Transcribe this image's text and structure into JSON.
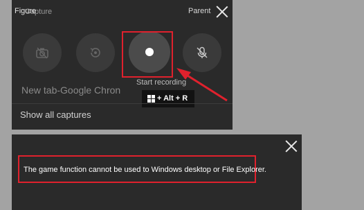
{
  "panel": {
    "title_figure": "Figure",
    "title_capture": "Capture",
    "parent_label": "Parent",
    "buttons": {
      "screenshot_icon": "camera-icon",
      "record_last_icon": "record-last-icon",
      "record_icon": "record-dot-icon",
      "mic_icon": "mic-off-icon"
    },
    "app_name": "New tab-Google Chron",
    "tooltip_label": "Start recording",
    "shortcut_text": "+ Alt + R",
    "show_all_label": "Show all captures"
  },
  "dialog": {
    "message": "The game function cannot be used to Windows desktop or File Explorer."
  },
  "colors": {
    "highlight": "#e0212d",
    "panel_bg": "#2a2a2a",
    "background": "#a3a3a3"
  }
}
